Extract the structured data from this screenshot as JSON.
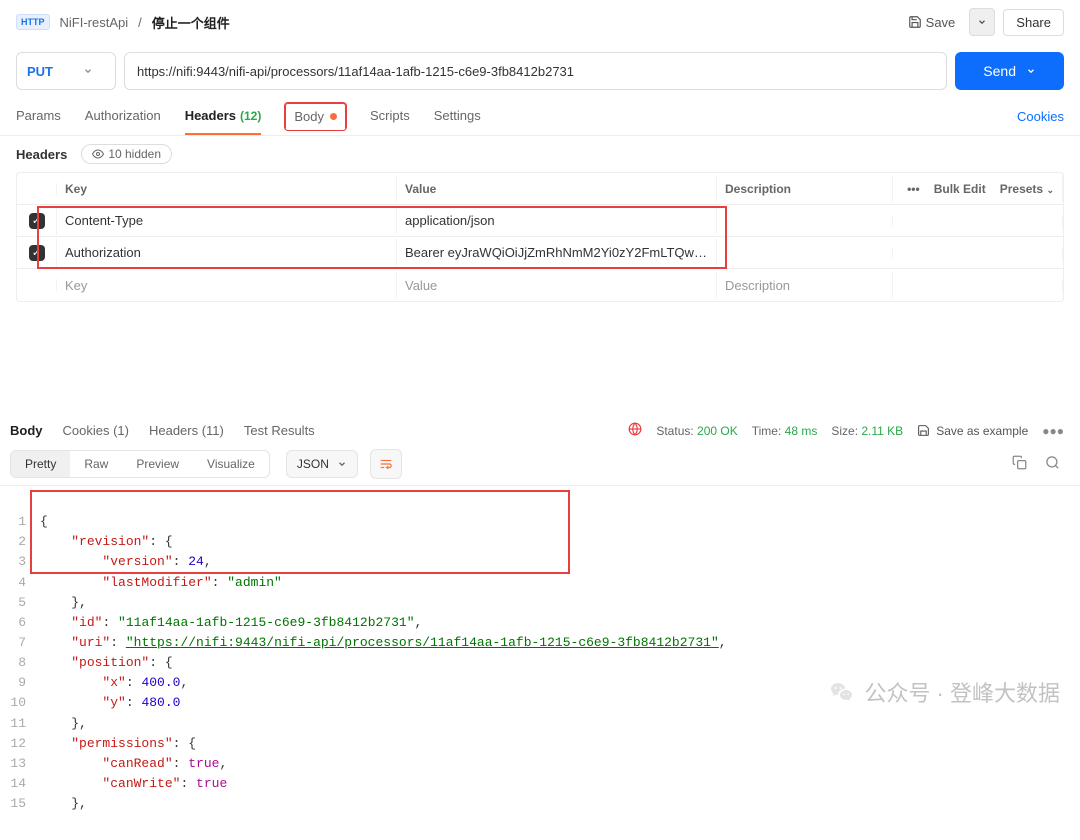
{
  "breadcrumb": {
    "workspace": "NiFI-restApi",
    "current": "停止一个组件"
  },
  "top": {
    "save": "Save",
    "share": "Share"
  },
  "request": {
    "method": "PUT",
    "url": "https://nifi:9443/nifi-api/processors/11af14aa-1afb-1215-c6e9-3fb8412b2731",
    "send": "Send"
  },
  "tabs": {
    "params": "Params",
    "auth": "Authorization",
    "headers": "Headers",
    "headers_count": "(12)",
    "body": "Body",
    "scripts": "Scripts",
    "settings": "Settings",
    "cookies": "Cookies"
  },
  "headers_sub": {
    "label": "Headers",
    "hidden": "10 hidden"
  },
  "table": {
    "cols": {
      "key": "Key",
      "value": "Value",
      "desc": "Description",
      "bulk": "Bulk Edit",
      "presets": "Presets"
    },
    "rows": [
      {
        "key": "Content-Type",
        "value": "application/json"
      },
      {
        "key": "Authorization",
        "value": "Bearer eyJraWQiOiJjZmRhNmM2Yi0zY2FmLTQwYTctO…"
      }
    ],
    "placeholder": {
      "key": "Key",
      "value": "Value",
      "desc": "Description"
    }
  },
  "resp_tabs": {
    "body": "Body",
    "cookies": "Cookies (1)",
    "headers": "Headers (11)",
    "tests": "Test Results"
  },
  "resp_meta": {
    "status_lbl": "Status:",
    "status_val": "200 OK",
    "time_lbl": "Time:",
    "time_val": "48 ms",
    "size_lbl": "Size:",
    "size_val": "2.11 KB",
    "save_ex": "Save as example"
  },
  "view": {
    "pretty": "Pretty",
    "raw": "Raw",
    "preview": "Preview",
    "visualize": "Visualize",
    "json": "JSON"
  },
  "chart_data": {
    "type": "table",
    "json": {
      "revision": {
        "version": 24,
        "lastModifier": "admin"
      },
      "id": "11af14aa-1afb-1215-c6e9-3fb8412b2731",
      "uri": "https://nifi:9443/nifi-api/processors/11af14aa-1afb-1215-c6e9-3fb8412b2731",
      "position": {
        "x": 400.0,
        "y": 480.0
      },
      "permissions": {
        "canRead": true,
        "canWrite": true
      }
    }
  },
  "code": {
    "l1": "{",
    "l2k": "\"revision\"",
    "l2p": ": {",
    "l3k": "\"version\"",
    "l3v": "24",
    "l3p": ",",
    "l4k": "\"lastModifier\"",
    "l4v": "\"admin\"",
    "l5": "},",
    "l6k": "\"id\"",
    "l6v": "\"11af14aa-1afb-1215-c6e9-3fb8412b2731\"",
    "l6p": ",",
    "l7k": "\"uri\"",
    "l7v": "\"https://nifi:9443/nifi-api/processors/11af14aa-1afb-1215-c6e9-3fb8412b2731\"",
    "l7p": ",",
    "l8k": "\"position\"",
    "l8p": ": {",
    "l9k": "\"x\"",
    "l9v": "400.0",
    "l9p": ",",
    "l10k": "\"y\"",
    "l10v": "480.0",
    "l11": "},",
    "l12k": "\"permissions\"",
    "l12p": ": {",
    "l13k": "\"canRead\"",
    "l13v": "true",
    "l13p": ",",
    "l14k": "\"canWrite\"",
    "l14v": "true",
    "l15": "},"
  },
  "watermark": "公众号 · 登峰大数据"
}
